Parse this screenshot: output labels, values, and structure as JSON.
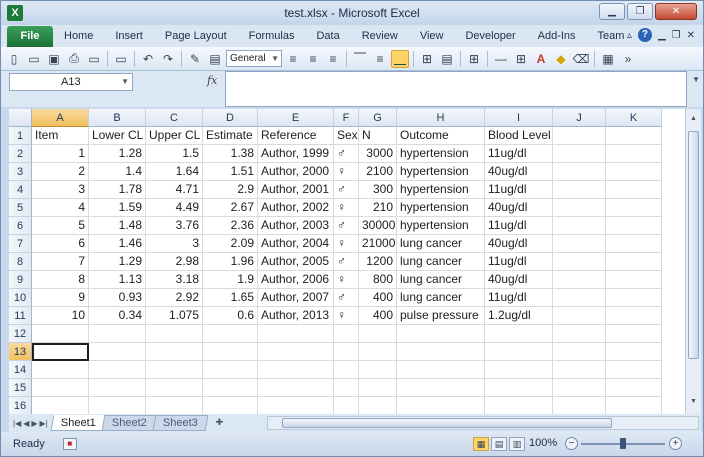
{
  "window": {
    "title": "test.xlsx - Microsoft Excel",
    "app_icon": "X",
    "minimize": "▁",
    "restore": "❐",
    "close": "✕"
  },
  "ribbon": {
    "file_label": "File",
    "tabs": [
      "Home",
      "Insert",
      "Page Layout",
      "Formulas",
      "Data",
      "Review",
      "View",
      "Developer",
      "Add-Ins",
      "Team"
    ],
    "help": "?"
  },
  "toolbar": {
    "number_format": "General"
  },
  "formula_bar": {
    "name_box": "A13",
    "fx": "fx",
    "formula": ""
  },
  "grid": {
    "columns": [
      "A",
      "B",
      "C",
      "D",
      "E",
      "F",
      "G",
      "H",
      "I",
      "J",
      "K"
    ],
    "selected_column": "A",
    "selected_row": 13,
    "rows": [
      [
        "Item",
        "Lower CL",
        "Upper CL",
        "Estimate",
        "Reference",
        "Sex",
        "N",
        "Outcome",
        "Blood Level",
        "",
        ""
      ],
      [
        "1",
        "1.28",
        "1.5",
        "1.38",
        "Author, 1999",
        "♂",
        "3000",
        "hypertension",
        "11ug/dl",
        "",
        ""
      ],
      [
        "2",
        "1.4",
        "1.64",
        "1.51",
        "Author, 2000",
        "♀",
        "2100",
        "hypertension",
        "40ug/dl",
        "",
        ""
      ],
      [
        "3",
        "1.78",
        "4.71",
        "2.9",
        "Author, 2001",
        "♂",
        "300",
        "hypertension",
        "11ug/dl",
        "",
        ""
      ],
      [
        "4",
        "1.59",
        "4.49",
        "2.67",
        "Author, 2002",
        "♀",
        "210",
        "hypertension",
        "40ug/dl",
        "",
        ""
      ],
      [
        "5",
        "1.48",
        "3.76",
        "2.36",
        "Author, 2003",
        "♂",
        "30000",
        "hypertension",
        "11ug/dl",
        "",
        ""
      ],
      [
        "6",
        "1.46",
        "3",
        "2.09",
        "Author, 2004",
        "♀",
        "21000",
        "lung cancer",
        "40ug/dl",
        "",
        ""
      ],
      [
        "7",
        "1.29",
        "2.98",
        "1.96",
        "Author, 2005",
        "♂",
        "1200",
        "lung cancer",
        "11ug/dl",
        "",
        ""
      ],
      [
        "8",
        "1.13",
        "3.18",
        "1.9",
        "Author, 2006",
        "♀",
        "800",
        "lung cancer",
        "40ug/dl",
        "",
        ""
      ],
      [
        "9",
        "0.93",
        "2.92",
        "1.65",
        "Author, 2007",
        "♂",
        "400",
        "lung cancer",
        "11ug/dl",
        "",
        ""
      ],
      [
        "10",
        "0.34",
        "1.075",
        "0.6",
        "Author, 2013",
        "♀",
        "400",
        "pulse pressure",
        "1.2ug/dl",
        "",
        ""
      ],
      [
        "",
        "",
        "",
        "",
        "",
        "",
        "",
        "",
        "",
        "",
        ""
      ],
      [
        "",
        "",
        "",
        "",
        "",
        "",
        "",
        "",
        "",
        "",
        ""
      ],
      [
        "",
        "",
        "",
        "",
        "",
        "",
        "",
        "",
        "",
        "",
        ""
      ],
      [
        "",
        "",
        "",
        "",
        "",
        "",
        "",
        "",
        "",
        "",
        ""
      ],
      [
        "",
        "",
        "",
        "",
        "",
        "",
        "",
        "",
        "",
        "",
        ""
      ]
    ]
  },
  "sheets": [
    "Sheet1",
    "Sheet2",
    "Sheet3"
  ],
  "active_sheet": "Sheet1",
  "status": {
    "text": "Ready",
    "zoom": "100%",
    "zoom_minus": "−",
    "zoom_plus": "+"
  }
}
